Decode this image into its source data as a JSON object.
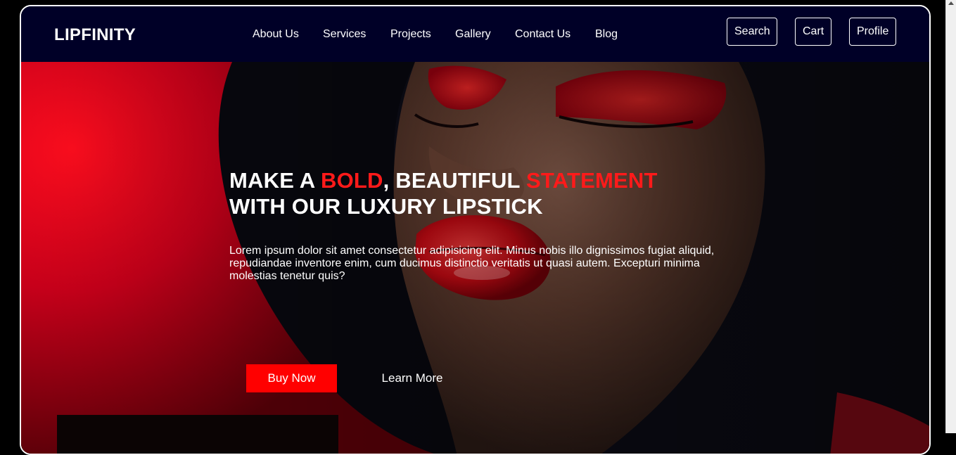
{
  "brand": {
    "name": "LIPFINITY"
  },
  "nav": {
    "links": [
      "About Us",
      "Services",
      "Projects",
      "Gallery",
      "Contact Us",
      "Blog"
    ],
    "buttons": {
      "search": "Search",
      "cart": "Cart",
      "profile": "Profile"
    }
  },
  "hero": {
    "title": {
      "part1": "MAKE A ",
      "bold_word": "BOLD",
      "part2": ", BEAUTIFUL ",
      "statement_word": "STATEMENT",
      "line2": "WITH OUR LUXURY LIPSTICK"
    },
    "description": "Lorem ipsum dolor sit amet consectetur adipisicing elit. Minus nobis illo dignissimos fugiat aliquid, repudiandae inventore enim, cum ducimus distinctio veritatis ut quasi autem. Excepturi minima molestias tenetur quis?",
    "buy_label": "Buy Now",
    "learn_label": "Learn More"
  },
  "colors": {
    "navbar_bg": "#000027",
    "accent_red": "#ff1a1a",
    "button_red": "#ff0000",
    "frame_border": "#ffffff"
  }
}
